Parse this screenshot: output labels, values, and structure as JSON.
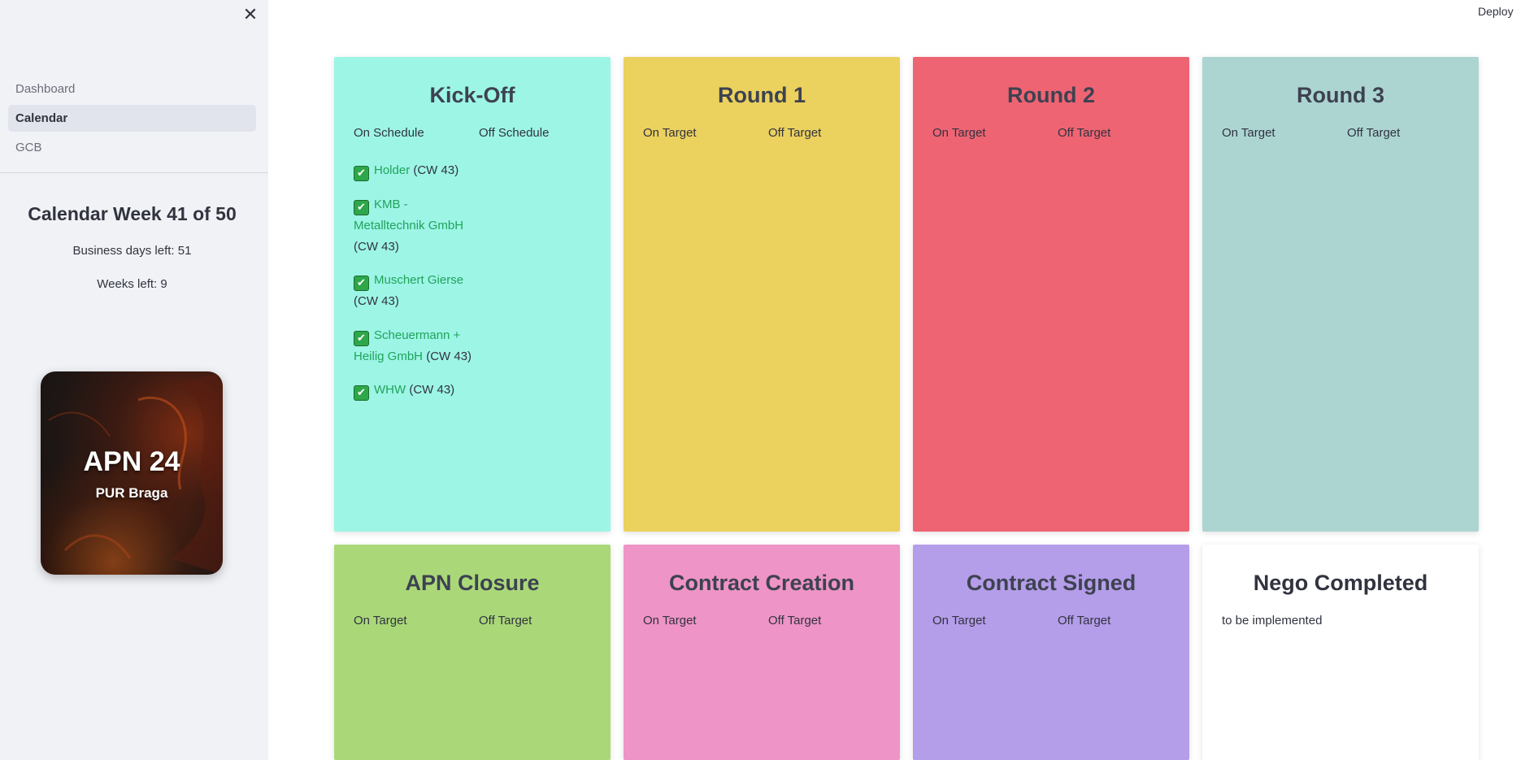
{
  "header": {
    "deploy_label": "Deploy"
  },
  "sidebar": {
    "close_icon": "close-icon",
    "nav": [
      {
        "label": "Dashboard",
        "active": false
      },
      {
        "label": "Calendar",
        "active": true
      },
      {
        "label": "GCB",
        "active": false
      }
    ],
    "week_title": "Calendar Week 41 of 50",
    "business_days": "Business days left: 51",
    "weeks_left": "Weeks left: 9",
    "logo": {
      "title": "APN 24",
      "subtitle": "PUR Braga"
    }
  },
  "board": {
    "columns": [
      {
        "title": "Kick-Off",
        "color": "#9df5e6",
        "left_label": "On Schedule",
        "right_label": "Off Schedule",
        "items": [
          {
            "name": "Holder",
            "week": "(CW 43)"
          },
          {
            "name": "KMB - Metalltechnik GmbH",
            "week": "(CW 43)"
          },
          {
            "name": "Muschert Gierse",
            "week": "(CW 43)"
          },
          {
            "name": "Scheuermann + Heilig GmbH",
            "week": "(CW 43)"
          },
          {
            "name": "WHW",
            "week": "(CW 43)"
          }
        ]
      },
      {
        "title": "Round 1",
        "color": "#ebd15e",
        "left_label": "On Target",
        "right_label": "Off Target"
      },
      {
        "title": "Round 2",
        "color": "#ef6473",
        "left_label": "On Target",
        "right_label": "Off Target"
      },
      {
        "title": "Round 3",
        "color": "#acd5d2",
        "left_label": "On Target",
        "right_label": "Off Target"
      },
      {
        "title": "APN Closure",
        "color": "#aad879",
        "left_label": "On Target",
        "right_label": "Off Target"
      },
      {
        "title": "Contract Creation",
        "color": "#ee94c6",
        "left_label": "On Target",
        "right_label": "Off Target"
      },
      {
        "title": "Contract Signed",
        "color": "#b49de9",
        "left_label": "On Target",
        "right_label": "Off Target"
      },
      {
        "title": "Nego Completed",
        "color": "#ffffff",
        "note": "to be implemented"
      }
    ]
  }
}
